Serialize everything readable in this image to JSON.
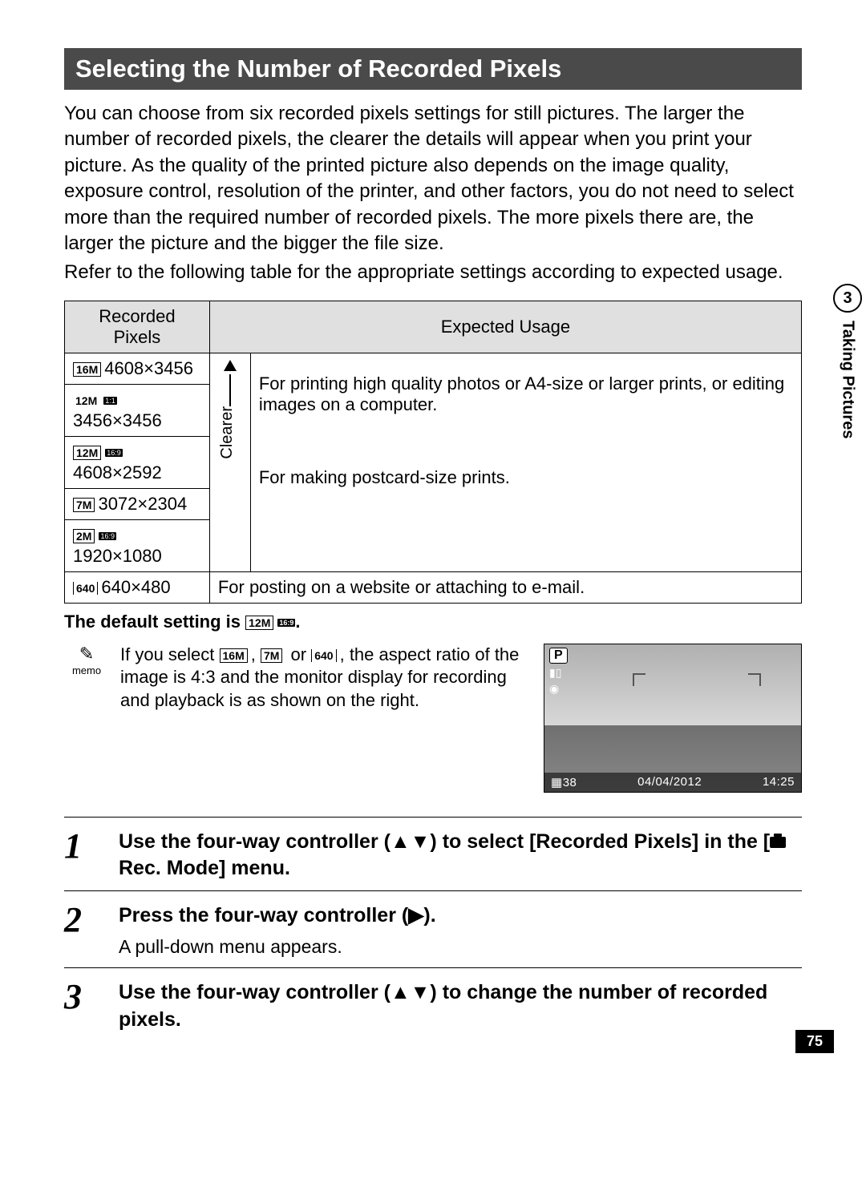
{
  "title": "Selecting the Number of Recorded Pixels",
  "intro": "You can choose from six recorded pixels settings for still pictures. The larger the number of recorded pixels, the clearer the details will appear when you print your picture. As the quality of the printed picture also depends on the image quality, exposure control, resolution of the printer, and other factors, you do not need to select more than the required number of recorded pixels. The more pixels there are, the larger the picture and the bigger the file size.",
  "intro2": "Refer to the following table for the appropriate settings according to expected usage.",
  "table": {
    "col1": "Recorded Pixels",
    "col2": "Expected Usage",
    "clearer": "Clearer",
    "rows": [
      {
        "icon": "16M",
        "aspect": "",
        "res": "4608×3456"
      },
      {
        "icon": "12M",
        "aspect": "1:1",
        "res": "3456×3456"
      },
      {
        "icon": "12M",
        "aspect": "16:9",
        "res": "4608×2592"
      },
      {
        "icon": "7M",
        "aspect": "",
        "res": "3072×2304"
      },
      {
        "icon": "2M",
        "aspect": "16:9",
        "res": "1920×1080"
      },
      {
        "icon": "640",
        "aspect": "",
        "res": "640×480"
      }
    ],
    "usage_top": "For printing high quality photos or A4-size or larger prints, or editing images on a computer.",
    "usage_mid": "For making postcard-size prints.",
    "usage_bot": "For posting on a website or attaching to e-mail."
  },
  "default_note_pre": "The default setting is ",
  "default_note_icon": "12M",
  "default_note_aspect": "16:9",
  "default_note_post": ".",
  "memo_label": "memo",
  "memo_pre": "If you select ",
  "memo_opt1": "16M",
  "memo_sep1": ", ",
  "memo_opt2": "7M",
  "memo_sep2": " or ",
  "memo_opt3": "640",
  "memo_post": ", the aspect ratio of the image is 4:3 and the monitor display for recording and playback is as shown on the right.",
  "screenshot": {
    "mode": "P",
    "count": "38",
    "date": "04/04/2012",
    "time": "14:25"
  },
  "steps": [
    {
      "num": "1",
      "text_pre": "Use the four-way controller (▲▼) to select [Recorded Pixels] in the [",
      "text_post": " Rec. Mode] menu.",
      "sub": ""
    },
    {
      "num": "2",
      "text_pre": "Press the four-way controller (▶).",
      "text_post": "",
      "sub": "A pull-down menu appears."
    },
    {
      "num": "3",
      "text_pre": "Use the four-way controller (▲▼) to change the number of recorded pixels.",
      "text_post": "",
      "sub": ""
    }
  ],
  "side": {
    "chapter": "3",
    "label": "Taking Pictures"
  },
  "page_num": "75"
}
